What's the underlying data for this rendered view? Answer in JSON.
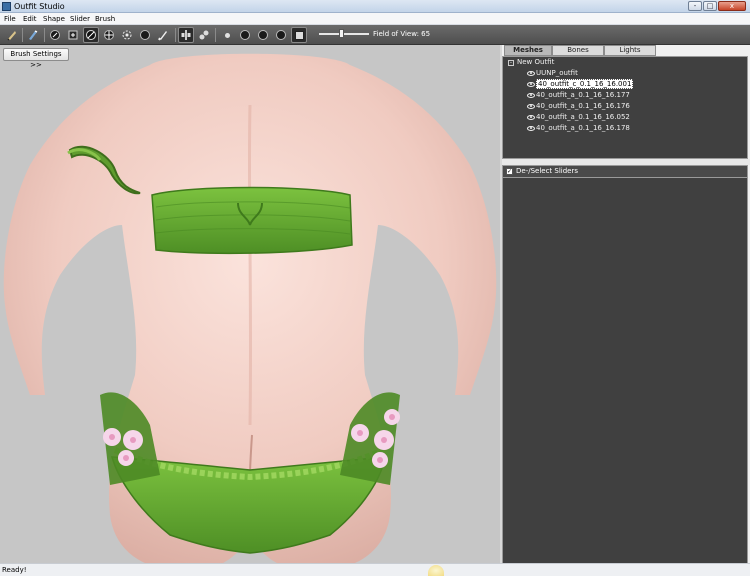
{
  "window": {
    "title": "Outfit Studio",
    "min_label": "-",
    "max_label": "□",
    "close_label": "x"
  },
  "menu": [
    "File",
    "Edit",
    "Shape",
    "Slider",
    "Brush"
  ],
  "toolbar": {
    "fov_label": "Field of View: 65",
    "fov_value": 65
  },
  "viewport": {
    "brush_settings_label": "Brush Settings >>"
  },
  "tabs": [
    {
      "label": "Meshes",
      "active": true
    },
    {
      "label": "Bones",
      "active": false
    },
    {
      "label": "Lights",
      "active": false
    }
  ],
  "tree": {
    "root": "New Outfit",
    "expander": "-",
    "items": [
      {
        "label": "UUNP_outfit",
        "selected": false
      },
      {
        "label": "40_outfit_c_0.1_16_16.001",
        "selected": true
      },
      {
        "label": "40_outfit_a_0.1_16_16.177",
        "selected": false
      },
      {
        "label": "40_outfit_a_0.1_16_16.176",
        "selected": false
      },
      {
        "label": "40_outfit_a_0.1_16_16.052",
        "selected": false
      },
      {
        "label": "40_outfit_a_0.1_16_16.178",
        "selected": false
      }
    ]
  },
  "sliders": {
    "label": "De-/Select Sliders",
    "checked": true,
    "check_glyph": "✓"
  },
  "status": {
    "text": "Ready!"
  },
  "colors": {
    "viewport_bg": "#c6c6c6",
    "panel_bg": "#404040",
    "toolbar_bg": "#5a5a5a",
    "skin": "#f1cfc6",
    "outfit_green": "#6fb03a"
  }
}
